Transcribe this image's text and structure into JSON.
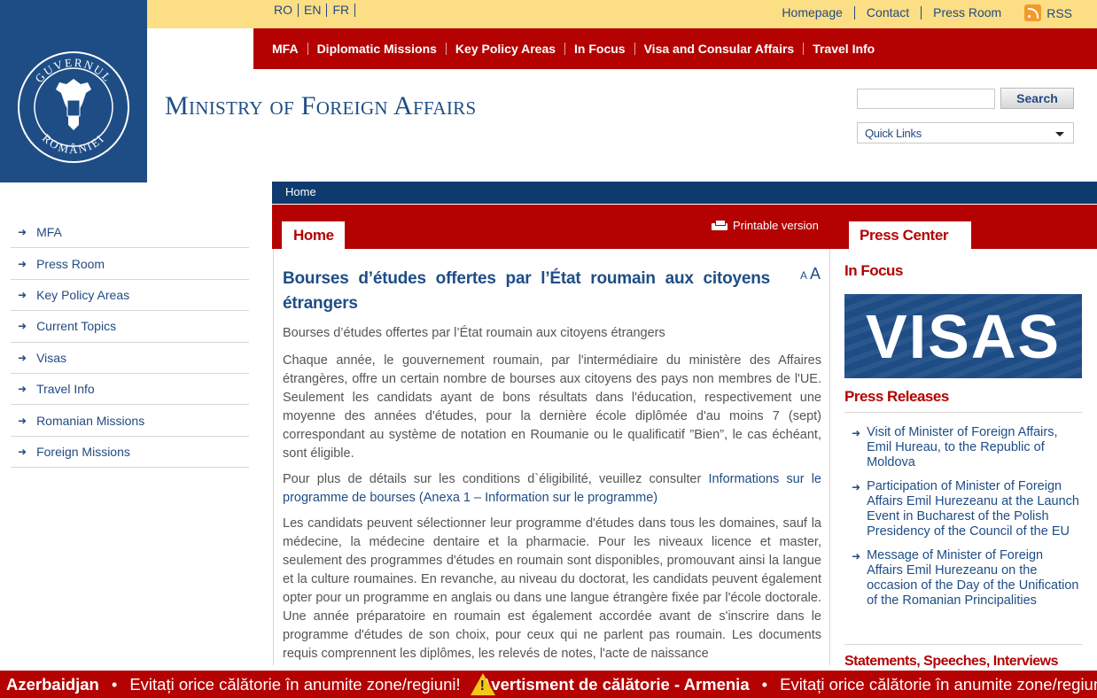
{
  "header": {
    "languages": [
      "RO",
      "EN",
      "FR"
    ],
    "top_links": [
      "Homepage",
      "Contact",
      "Press Room"
    ],
    "rss_label": "RSS",
    "logo_text": "GUVERNUL ROMÂNIEI",
    "site_title": "Ministry of Foreign Affairs",
    "search_button": "Search",
    "search_placeholder": "",
    "quick_links": "Quick Links"
  },
  "main_nav": [
    "MFA",
    "Diplomatic Missions",
    "Key Policy Areas",
    "In Focus",
    "Visa and Consular Affairs",
    "Travel Info"
  ],
  "breadcrumb": "Home",
  "tabs": {
    "home": "Home",
    "printable": "Printable version",
    "press_center": "Press Center"
  },
  "sidebar": [
    "MFA",
    "Press Room",
    "Key Policy Areas",
    "Current Topics",
    "Visas",
    "Travel Info",
    "Romanian Missions",
    "Foreign Missions"
  ],
  "article": {
    "title": "Bourses d’études offertes par l’État roumain aux citoyens étrangers",
    "font_small": "A",
    "font_large": "A",
    "subtitle": "Bourses d’études offertes par l’État roumain aux citoyens étrangers",
    "para1": "Chaque année, le gouvernement roumain, par l'intermédiaire du ministère des Affaires étrangères, offre un certain nombre de bourses aux citoyens des pays non membres de l'UE. Seulement les candidats ayant de bons résultats dans l'éducation, respectivement une moyenne des années d'études, pour la dernière école diplômée d'au moins 7 (sept) correspondant au système de notation en Roumanie ou le qualificatif ”Bien”, le cas échéant, sont éligible.",
    "para2_text": "Pour plus de détails sur les conditions d`éligibilité, veuillez consulter ",
    "para2_link": "Informations sur le programme de bourses (Anexa 1 – Information sur le programme)",
    "para3": "Les candidats peuvent sélectionner leur programme d'études dans tous les domaines, sauf la médecine, la médecine dentaire et la pharmacie. Pour les niveaux licence et master, seulement des programmes d'études en roumain sont disponibles, promouvant ainsi la langue et la culture roumaines. En revanche, au niveau du doctorat, les candidats peuvent également opter pour un programme en anglais ou dans une langue étrangère fixée par l'école doctorale. Une année préparatoire en roumain est également accordée avant de s'inscrire dans le programme d'études de son choix, pour ceux qui ne parlent pas roumain. Les documents requis comprennent les diplômes, les relevés de notes, l'acte de naissance"
  },
  "right": {
    "in_focus": "In Focus",
    "banner_text": "VISAS",
    "press_releases": "Press Releases",
    "releases": [
      "Visit of Minister of Foreign Affairs, Emil Hureau, to the Republic of Moldova",
      "Participation of Minister of Foreign Affairs Emil Hurezeanu at the Launch Event in Bucharest of the Polish Presidency of the Council of the EU",
      "Message of Minister of Foreign Affairs Emil Hurezeanu on the occasion of the Day of the Unification of the Romanian Principalities"
    ],
    "statements": "Statements, Speeches, Interviews"
  },
  "ticker": {
    "item1": "Azerbaidjan",
    "sep": "•",
    "item2": "Evitați orice călătorie în anumite zone/regiuni!",
    "item3": "Avertisment de călătorie - Armenia",
    "item4": "Evitați orice călătorie în anumite zone/regiuni!"
  },
  "colors": {
    "brand_blue": "#1e4d86",
    "brand_red": "#b40202",
    "topbar_yellow": "#fcde84"
  }
}
